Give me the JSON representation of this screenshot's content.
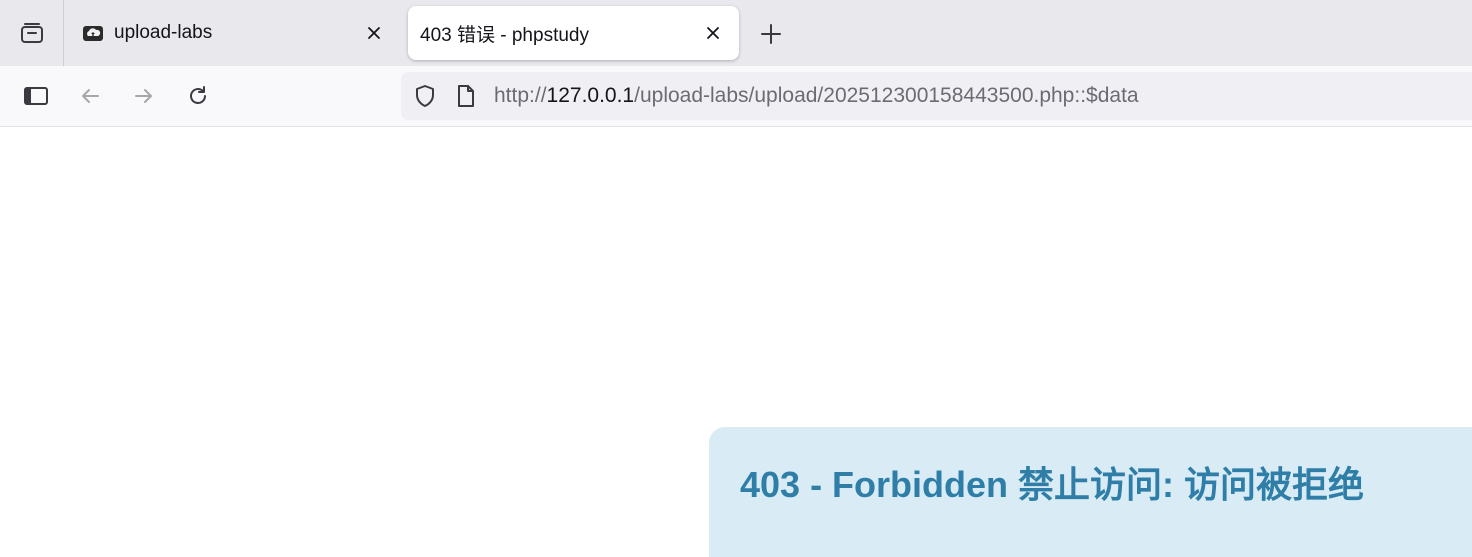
{
  "tabs": [
    {
      "title": "upload-labs",
      "favicon": "cloud-folder-icon",
      "active": false
    },
    {
      "title": "403 错误 - phpstudy",
      "favicon": "",
      "active": true
    }
  ],
  "navbar": {
    "url_scheme": "http://",
    "url_host": "127.0.0.1",
    "url_path": "/upload-labs/upload/202512300158443500.php::$data"
  },
  "page": {
    "error_title": "403 - Forbidden 禁止访问: 访问被拒绝",
    "error_box_color": "#d9ebf5",
    "error_text_color": "#2e7ea8"
  }
}
